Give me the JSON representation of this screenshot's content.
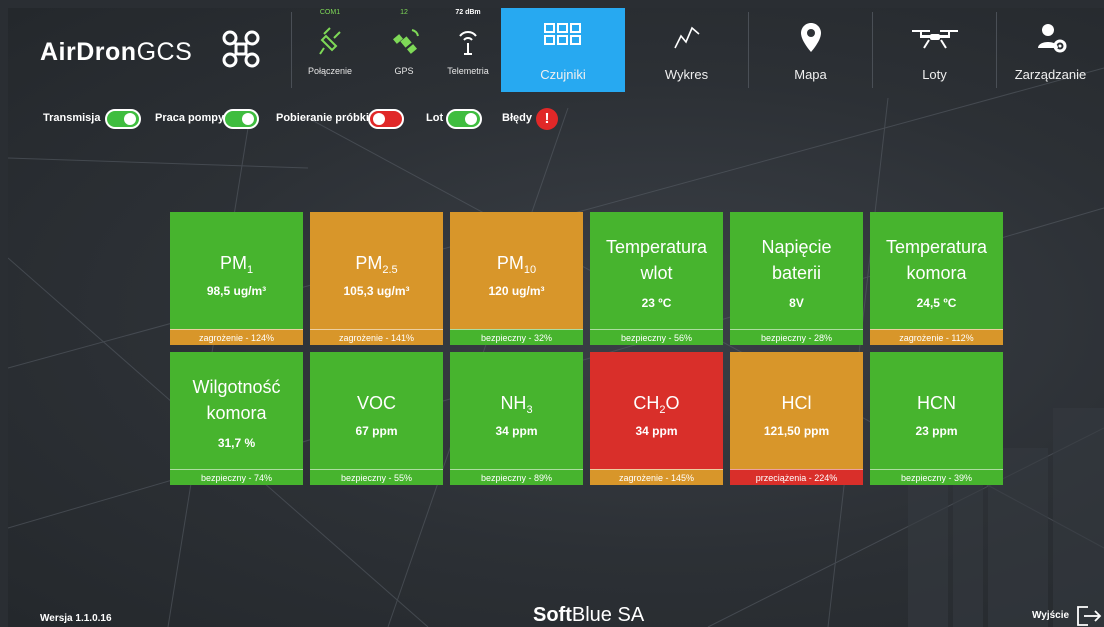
{
  "app": {
    "logo_bold": "AirDron",
    "logo_light": "GCS",
    "version": "Wersja 1.1.0.16",
    "brand_bold": "Soft",
    "brand_light": "Blue SA",
    "exit_label": "Wyjście"
  },
  "status": {
    "connection": {
      "top": "COM1",
      "label": "Połączenie",
      "icon": "plug-icon"
    },
    "gps": {
      "top": "12",
      "label": "GPS",
      "icon": "satellite-icon"
    },
    "telemetry": {
      "top": "72 dBm",
      "label": "Telemetria",
      "icon": "antenna-icon"
    }
  },
  "nav": [
    {
      "label": "Czujniki",
      "icon": "grid-icon",
      "active": true
    },
    {
      "label": "Wykres",
      "icon": "chart-line-icon"
    },
    {
      "label": "Mapa",
      "icon": "map-pin-icon"
    },
    {
      "label": "Loty",
      "icon": "drone-icon"
    },
    {
      "label": "Zarządzanie",
      "icon": "user-gear-icon"
    }
  ],
  "toggles": [
    {
      "label": "Transmisja",
      "state": "on"
    },
    {
      "label": "Praca pompy",
      "state": "on"
    },
    {
      "label": "Pobieranie próbki",
      "state": "off"
    },
    {
      "label": "Lot",
      "state": "on"
    }
  ],
  "errors": {
    "label": "Błędy",
    "symbol": "!"
  },
  "tiles": [
    {
      "name": "PM",
      "sub": "1",
      "value": "98,5 ug/m³",
      "status": "zagrożenie - 124%",
      "color": "#47b42e",
      "foot_color": "#d8962a"
    },
    {
      "name": "PM",
      "sub": "2.5",
      "value": "105,3 ug/m³",
      "status": "zagrożenie - 141%",
      "color": "#d8962a",
      "foot_color": "#d8962a"
    },
    {
      "name": "PM",
      "sub": "10",
      "value": "120 ug/m³",
      "status": "bezpieczny - 32%",
      "color": "#d8962a",
      "foot_color": "#47b42e"
    },
    {
      "name": "Temperatura wlot",
      "value": "23 ºC",
      "status": "bezpieczny - 56%",
      "color": "#47b42e",
      "foot_color": "#47b42e"
    },
    {
      "name": "Napięcie baterii",
      "value": "8V",
      "status": "bezpieczny - 28%",
      "color": "#47b42e",
      "foot_color": "#47b42e"
    },
    {
      "name": "Temperatura komora",
      "value": "24,5 ºC",
      "status": "zagrożenie - 112%",
      "color": "#47b42e",
      "foot_color": "#d8962a"
    },
    {
      "name": "Wilgotność komora",
      "value": "31,7 %",
      "status": "bezpieczny - 74%",
      "color": "#47b42e",
      "foot_color": "#47b42e"
    },
    {
      "name": "VOC",
      "value": "67 ppm",
      "status": "bezpieczny - 55%",
      "color": "#47b42e",
      "foot_color": "#47b42e"
    },
    {
      "name": "NH",
      "sub": "3",
      "value": "34 ppm",
      "status": "bezpieczny - 89%",
      "color": "#47b42e",
      "foot_color": "#47b42e"
    },
    {
      "name": "CH",
      "sub": "2",
      "name_after": "O",
      "value": "34 ppm",
      "status": "zagrożenie - 145%",
      "color": "#d92f2a",
      "foot_color": "#d8962a"
    },
    {
      "name": "HCl",
      "value": "121,50 ppm",
      "status": "przeciążenia - 224%",
      "color": "#d8962a",
      "foot_color": "#d92f2a"
    },
    {
      "name": "HCN",
      "value": "23 ppm",
      "status": "bezpieczny - 39%",
      "color": "#47b42e",
      "foot_color": "#47b42e"
    }
  ]
}
